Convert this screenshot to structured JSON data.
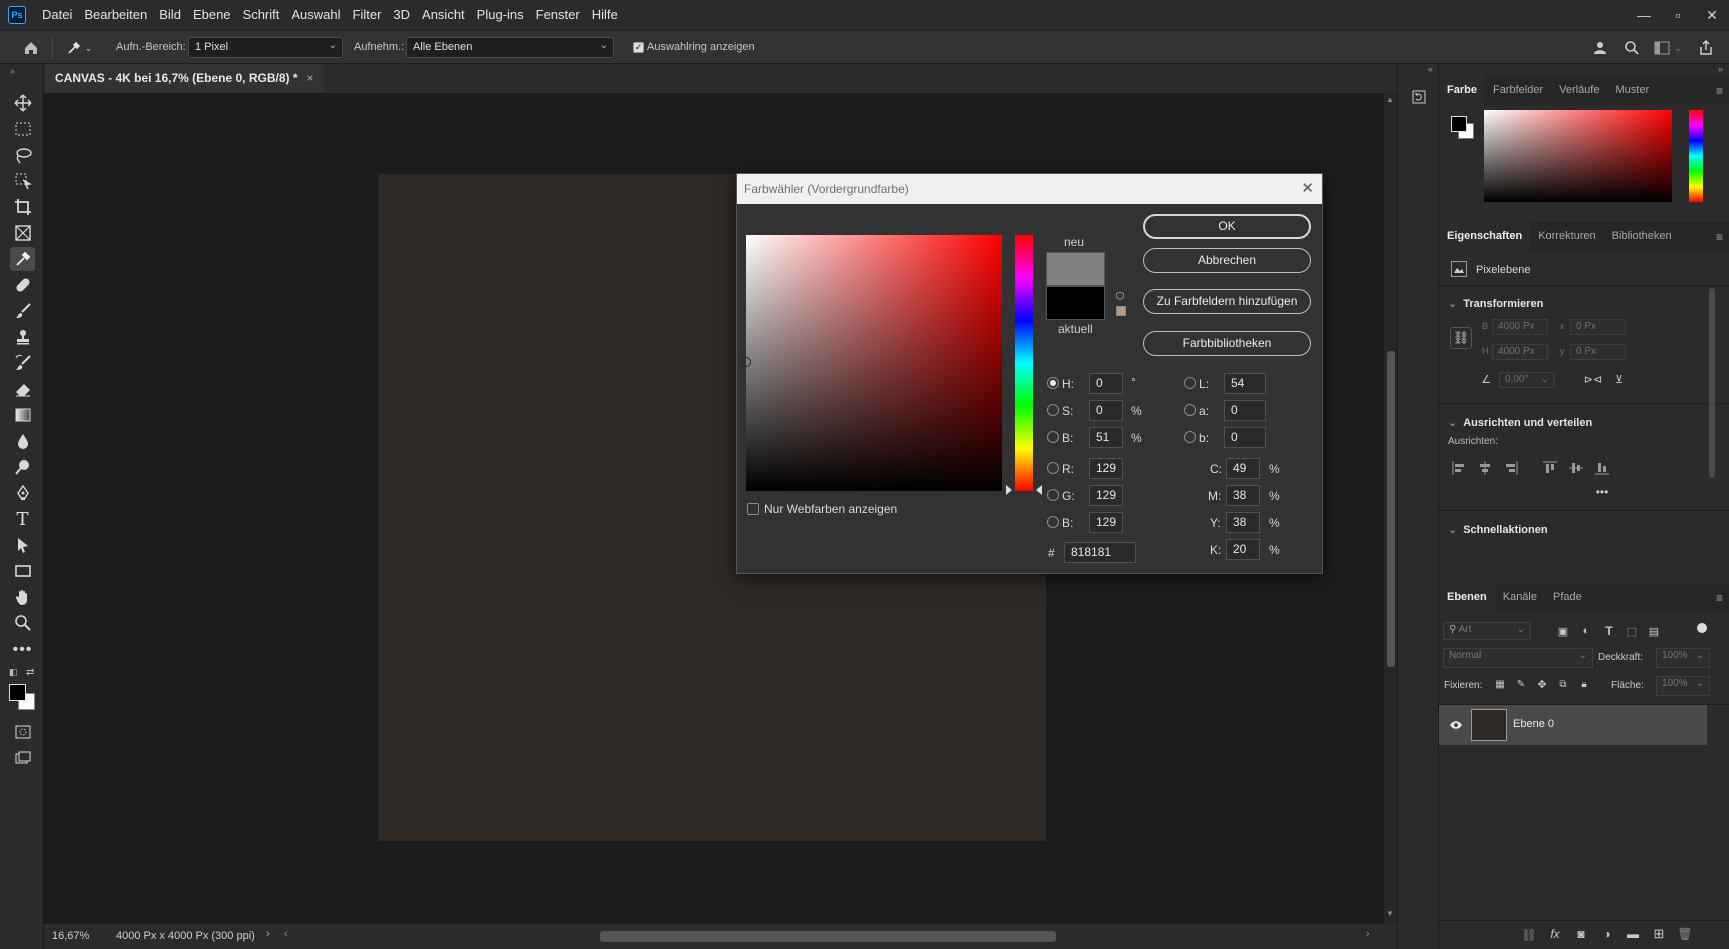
{
  "menubar": {
    "logo": "Ps",
    "items": [
      "Datei",
      "Bearbeiten",
      "Bild",
      "Ebene",
      "Schrift",
      "Auswahl",
      "Filter",
      "3D",
      "Ansicht",
      "Plug-ins",
      "Fenster",
      "Hilfe"
    ]
  },
  "options": {
    "sample_size_label": "Aufn.-Bereich:",
    "sample_size_value": "1 Pixel",
    "sample_label": "Aufnehm.:",
    "sample_value": "Alle Ebenen",
    "show_ring_label": "Auswahlring anzeigen"
  },
  "document": {
    "tab_title": "CANVAS - 4K bei 16,7% (Ebene 0, RGB/8) *",
    "canvas_color": "#2f2925"
  },
  "status": {
    "zoom": "16,67%",
    "doc_info": "4000 Px x 4000 Px (300 ppi)"
  },
  "color_panel": {
    "tabs": [
      "Farbe",
      "Farbfelder",
      "Verläufe",
      "Muster"
    ]
  },
  "properties_panel": {
    "tabs": [
      "Eigenschaften",
      "Korrekturen",
      "Bibliotheken"
    ],
    "layer_type": "Pixelebene",
    "transform_title": "Transformieren",
    "w_label": "B",
    "w_value": "4000 Px",
    "x_label": "x",
    "x_value": "0 Px",
    "h_label": "H",
    "h_value": "4000 Px",
    "y_label": "y",
    "y_value": "0 Px",
    "angle_value": "0,00°",
    "align_title": "Ausrichten und verteilen",
    "align_label": "Ausrichten:",
    "quick_title": "Schnellaktionen"
  },
  "layers_panel": {
    "tabs": [
      "Ebenen",
      "Kanäle",
      "Pfade"
    ],
    "filter_placeholder": "Art",
    "blend_mode": "Normal",
    "opacity_label": "Deckkraft:",
    "opacity_value": "100%",
    "lock_label": "Fixieren:",
    "fill_label": "Fläche:",
    "fill_value": "100%",
    "layers": [
      {
        "name": "Ebene 0"
      }
    ]
  },
  "color_picker": {
    "title": "Farbwähler (Vordergrundfarbe)",
    "new_label": "neu",
    "current_label": "aktuell",
    "new_color": "#818181",
    "current_color": "#000000",
    "buttons": {
      "ok": "OK",
      "cancel": "Abbrechen",
      "add_swatch": "Zu Farbfeldern hinzufügen",
      "libraries": "Farbbibliotheken"
    },
    "web_only_label": "Nur Webfarben anzeigen",
    "hsb": {
      "h_label": "H:",
      "h": "0",
      "h_unit": "°",
      "s_label": "S:",
      "s": "0",
      "s_unit": "%",
      "b_label": "B:",
      "b": "51",
      "b_unit": "%"
    },
    "rgb": {
      "r_label": "R:",
      "r": "129",
      "g_label": "G:",
      "g": "129",
      "b_label": "B:",
      "b": "129"
    },
    "lab": {
      "l_label": "L:",
      "l": "54",
      "a_label": "a:",
      "a": "0",
      "b_label": "b:",
      "b": "0"
    },
    "cmyk": {
      "c_label": "C:",
      "c": "49",
      "m_label": "M:",
      "m": "38",
      "y_label": "Y:",
      "y": "38",
      "k_label": "K:",
      "k": "20",
      "unit": "%"
    },
    "hex_label": "#",
    "hex": "818181"
  }
}
